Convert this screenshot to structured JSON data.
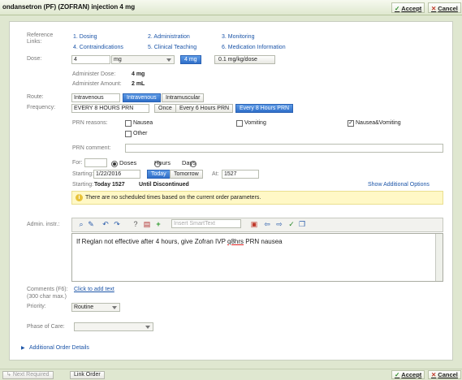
{
  "header": {
    "title": "ondansetron (PF) (ZOFRAN) injection 4 mg",
    "accept": "Accept",
    "cancel": "Cancel"
  },
  "reference": {
    "label": "Reference Links:",
    "links": [
      "1. Dosing",
      "2. Administration",
      "3. Monitoring",
      "4. Contraindications",
      "5. Clinical Teaching",
      "6. Medication Information"
    ]
  },
  "dose": {
    "label": "Dose:",
    "value": "4",
    "unit": "mg",
    "quick1": "4 mg",
    "quick2": "0.1 mg/kg/dose",
    "admin_dose_label": "Administer Dose:",
    "admin_dose_value": "4 mg",
    "admin_amount_label": "Administer Amount:",
    "admin_amount_value": "2 mL"
  },
  "route": {
    "label": "Route:",
    "value": "Intravenous",
    "opt1": "Intravenous",
    "opt2": "Intramuscular"
  },
  "frequency": {
    "label": "Frequency:",
    "value": "EVERY 8 HOURS PRN",
    "opt1": "Once",
    "opt2": "Every 6 Hours PRN",
    "opt3": "Every 8 Hours PRN"
  },
  "prn": {
    "reasons_label": "PRN reasons:",
    "nausea": "Nausea",
    "vomiting": "Vomiting",
    "nausea_vomiting": "Nausea&Vomiting",
    "other": "Other",
    "comment_label": "PRN comment:"
  },
  "duration": {
    "for_label": "For:",
    "doses": "Doses",
    "hours": "Hours",
    "days": "Days",
    "starting_label": "Starting:",
    "start_date": "1/22/2016",
    "today": "Today",
    "tomorrow": "Tomorrow",
    "at_label": "At:",
    "start_time": "1527",
    "starting_summary_label": "Starting:",
    "starting_summary": "Today 1527",
    "until": "Until Discontinued",
    "show_options": "Show Additional Options"
  },
  "info_message": "There are no scheduled times based on the current order parameters.",
  "admin_instr": {
    "label": "Admin. instr.:",
    "smarttext_placeholder": "Insert SmartText",
    "text_before": "If Reglan not effective after 4 hours, give Zofran IVP ",
    "text_underlined": "q8hrs",
    "text_after": " PRN nausea"
  },
  "comments": {
    "label": "Comments (F6):",
    "link": "Click to add text",
    "limit": "(300 char max.)"
  },
  "priority": {
    "label": "Priority:",
    "value": "Routine"
  },
  "phase": {
    "label": "Phase of Care:"
  },
  "additional_details": "Additional Order Details",
  "footer": {
    "next_required": "Next Required",
    "link_order": "Link Order",
    "accept": "Accept",
    "cancel": "Cancel"
  }
}
